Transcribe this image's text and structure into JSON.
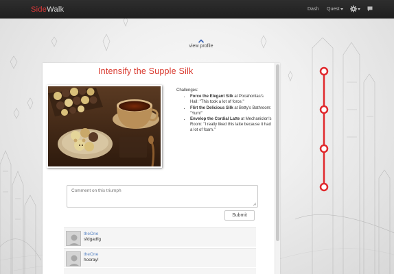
{
  "navbar": {
    "brand_part1": "Side",
    "brand_part2": "Walk",
    "dash_label": "Dash",
    "quest_label": "Quest",
    "settings_icon": "gear-icon",
    "messages_icon": "chat-icon"
  },
  "profile": {
    "view_profile_label": "view profile"
  },
  "triumph": {
    "title": "Intensify the Supple Silk",
    "challenges_heading": "Challenges:",
    "challenges": [
      {
        "name": "Force the Elegant Silk",
        "place": " at Pocahontas's Hall: \"This took a lot of force.\""
      },
      {
        "name": "Flirt the Delicious Silk",
        "place": " at Betty's Bathroom: \"Yum!\""
      },
      {
        "name": "Envelop the Cordial Latte",
        "place": " at Mechaniclon's Room: \"I really liked this latte because it had a lot of foam.\""
      }
    ]
  },
  "comment_form": {
    "placeholder": "Comment on this triumph",
    "submit_label": "Submit"
  },
  "comments": [
    {
      "author": "theOne",
      "text": "sfdgadfg"
    },
    {
      "author": "theOne",
      "text": "hooray!"
    }
  ],
  "colors": {
    "accent": "#d8372c",
    "navbar": "#262626",
    "link": "#5b86c4"
  }
}
